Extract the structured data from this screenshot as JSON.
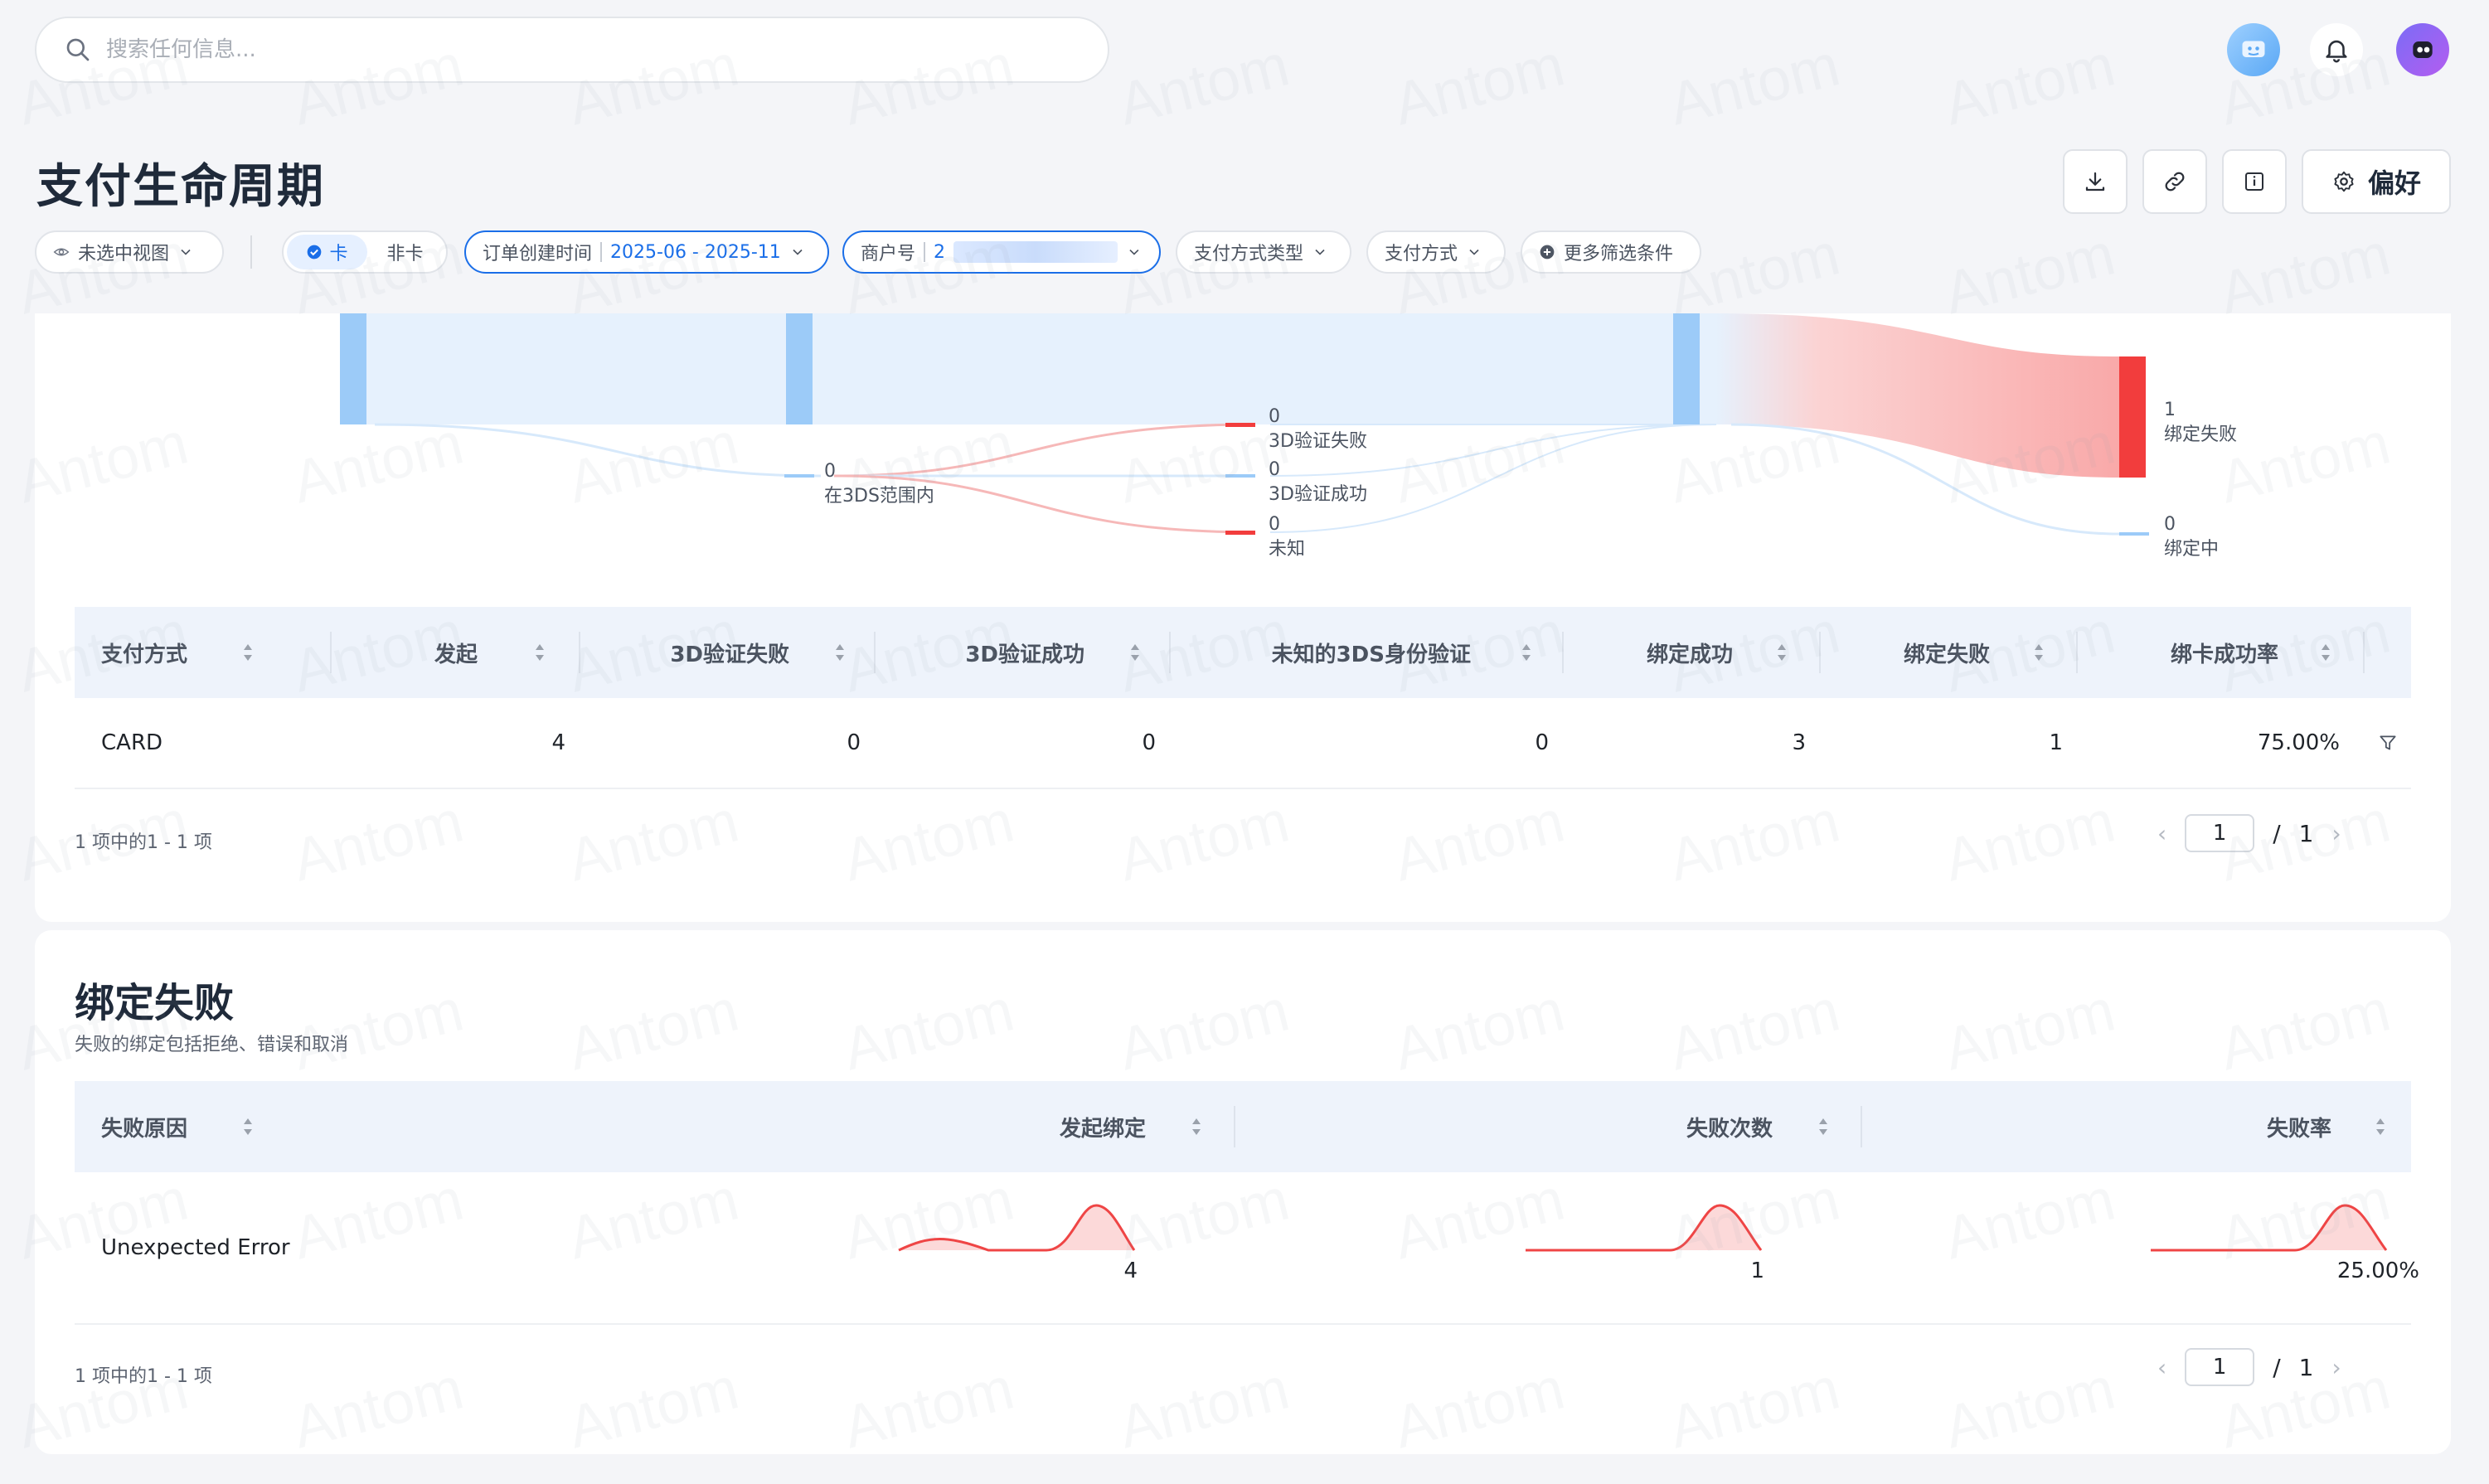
{
  "search": {
    "placeholder": "搜索任何信息..."
  },
  "header": {
    "title": "支付生命周期",
    "pref_label": "偏好"
  },
  "filters": {
    "view": "未选中视图",
    "card_on": "卡",
    "card_off": "非卡",
    "date_label": "订单创建时间",
    "date_value": "2025-06 - 2025-11",
    "merchant_label": "商户号",
    "merchant_value": "2",
    "payment_type": "支付方式类型",
    "payment_method": "支付方式",
    "more": "更多筛选条件"
  },
  "sankey": {
    "nodes": [
      {
        "value": "0",
        "label": "在3DS范围内"
      },
      {
        "value": "0",
        "label": "3D验证失败"
      },
      {
        "value": "0",
        "label": "3D验证成功"
      },
      {
        "value": "0",
        "label": "未知"
      },
      {
        "value": "1",
        "label": "绑定失败"
      },
      {
        "value": "0",
        "label": "绑定中"
      }
    ],
    "colors": {
      "flow": "#e6f1fd",
      "node": "#9ccbf8",
      "fail": "#f23d3d",
      "fail_flow": "#fbbcbc"
    }
  },
  "lifecycle_table": {
    "columns": [
      "支付方式",
      "发起",
      "3D验证失败",
      "3D验证成功",
      "未知的3DS身份验证",
      "绑定成功",
      "绑定失败",
      "绑卡成功率"
    ],
    "rows": [
      [
        "CARD",
        "4",
        "0",
        "0",
        "0",
        "3",
        "1",
        "75.00%"
      ]
    ],
    "pagination_text": "1 项中的1 - 1 项",
    "page": "1",
    "total_pages": "1"
  },
  "failure_section": {
    "title": "绑定失败",
    "subtitle": "失败的绑定包括拒绝、错误和取消",
    "columns": [
      "失败原因",
      "发起绑定",
      "失败次数",
      "失败率"
    ],
    "rows": [
      {
        "reason": "Unexpected Error",
        "initiated": "4",
        "failures": "1",
        "rate": "25.00%"
      }
    ],
    "pagination_text": "1 项中的1 - 1 项",
    "page": "1",
    "total_pages": "1"
  },
  "watermark": "Antom"
}
